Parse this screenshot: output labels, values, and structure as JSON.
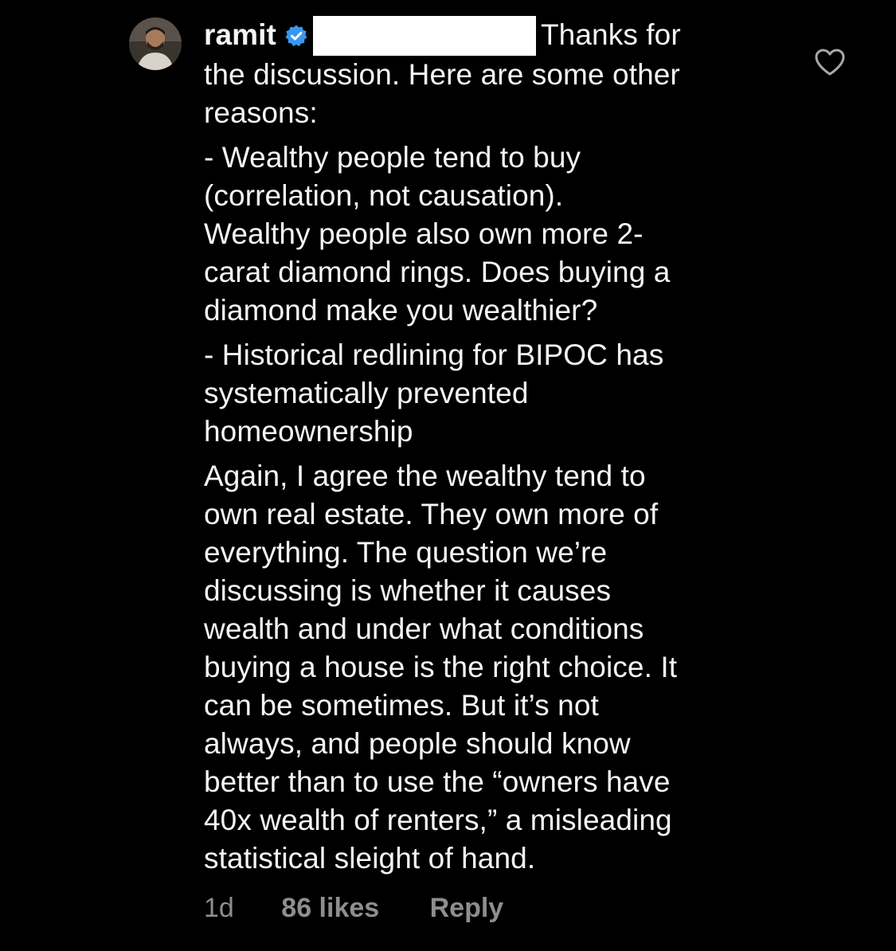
{
  "comment": {
    "username": "ramit",
    "verified": true,
    "first_line_text": "Thanks for",
    "intro_lines": "the discussion. Here are some other\nreasons:",
    "paragraphs": [
      "- Wealthy people tend to buy\n(correlation, not causation).\nWealthy people also own more 2-\ncarat diamond rings. Does buying a\ndiamond make you wealthier?",
      "- Historical redlining for BIPOC has\nsystematically prevented\nhomeownership",
      "Again, I agree the wealthy tend to\nown real estate. They own more of\neverything. The question we’re\ndiscussing is whether it causes\nwealth and under what conditions\nbuying a house is the right choice. It\ncan be sometimes. But it’s not\nalways, and people should know\nbetter than to use the “owners have\n40x wealth of renters,” a misleading\nstatistical sleight of hand."
    ],
    "time": "1d",
    "likes": "86 likes",
    "reply_label": "Reply"
  },
  "icons": {
    "verified_badge": "verified-badge-icon",
    "like": "heart-outline-icon"
  },
  "colors": {
    "background": "#000000",
    "text": "#f5f5f5",
    "meta_text": "#8e8e8e",
    "verified_blue": "#3897f0",
    "redaction": "#ffffff"
  }
}
